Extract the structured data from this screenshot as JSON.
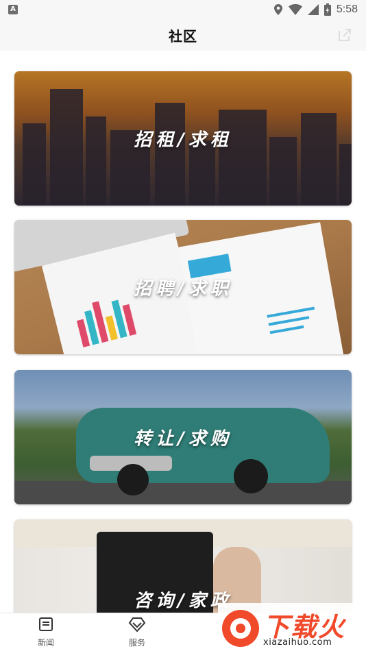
{
  "statusbar": {
    "time": "5:58",
    "notification_glyph": "A"
  },
  "header": {
    "title": "社区"
  },
  "cards": [
    {
      "label": "招租/求租"
    },
    {
      "label": "招聘/求职"
    },
    {
      "label": "转让/求购"
    },
    {
      "label": "咨询/家政"
    }
  ],
  "bottom_nav": [
    {
      "label": "新闻",
      "icon": "news-icon"
    },
    {
      "label": "服务",
      "icon": "heart-diamond-icon"
    }
  ],
  "watermark": {
    "text_cn": "下载火",
    "text_en": "xiazaihuo.com"
  },
  "colors": {
    "watermark": "#f04a2b",
    "title": "#111111",
    "nav_label": "#555555"
  }
}
